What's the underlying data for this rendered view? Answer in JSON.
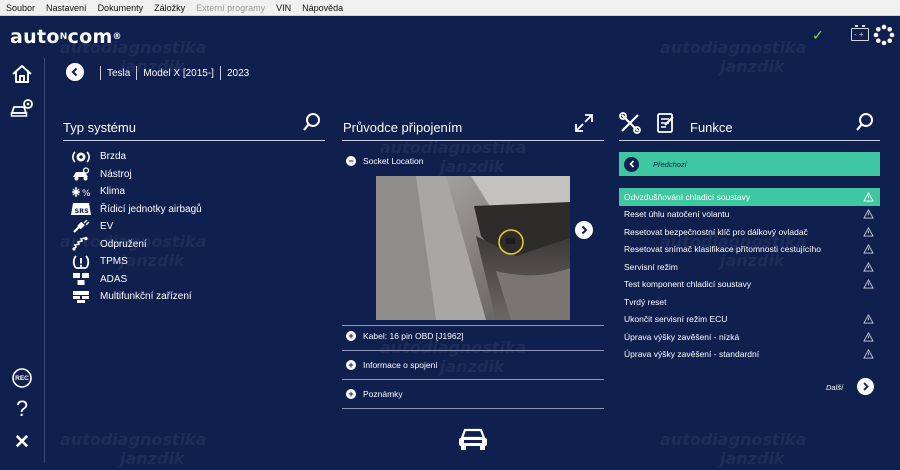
{
  "menubar": {
    "items": [
      "Soubor",
      "Nastavení",
      "Dokumenty",
      "Záložky",
      "Externí programy",
      "VIN",
      "Nápověda"
    ]
  },
  "header": {
    "logo": "auto",
    "logo_mid": "N",
    "logo_end": "com",
    "logo_mark": "®",
    "status_check": "✓"
  },
  "breadcrumb": {
    "make": "Tesla",
    "model": "Model X [2015-]",
    "year": "2023"
  },
  "watermark": {
    "line1": "autodiagnostika",
    "line2": "janzdik"
  },
  "left_panel": {
    "title": "Typ systému",
    "items": [
      {
        "label": "Brzda",
        "icon": "brake-icon"
      },
      {
        "label": "Nástroj",
        "icon": "tool-icon"
      },
      {
        "label": "Klima",
        "icon": "climate-icon"
      },
      {
        "label": "Řídicí jednotky airbagů",
        "icon": "srs-icon",
        "badge": "SRS"
      },
      {
        "label": "EV",
        "icon": "ev-plug-icon"
      },
      {
        "label": "Odpružení",
        "icon": "suspension-icon"
      },
      {
        "label": "TPMS",
        "icon": "tpms-icon"
      },
      {
        "label": "ADAS",
        "icon": "adas-icon"
      },
      {
        "label": "Multifunkční zařízení",
        "icon": "multifunction-icon"
      }
    ]
  },
  "middle_panel": {
    "title": "Průvodce připojením",
    "sections": [
      {
        "label": "Socket Location",
        "expanded": true
      },
      {
        "label": "Kabel: 16 pin OBD [J1962]",
        "expanded": false
      },
      {
        "label": "Informace o spojení",
        "expanded": false
      },
      {
        "label": "Poznámky",
        "expanded": false
      }
    ]
  },
  "right_panel": {
    "title": "Funkce",
    "previous_label": "Předchozí",
    "functions": [
      {
        "label": "Odvzdušňování chladicí soustavy",
        "warning": true,
        "selected": true
      },
      {
        "label": "Reset úhlu natočení volantu",
        "warning": true
      },
      {
        "label": "Resetovat bezpečnostní klíč pro dálkový ovladač",
        "warning": true
      },
      {
        "label": "Resetovat snímač klasifikace přítomnosti cestujícího",
        "warning": true
      },
      {
        "label": "Servisní režim",
        "warning": true
      },
      {
        "label": "Test komponent chladicí soustavy",
        "warning": true
      },
      {
        "label": "Tvrdý reset",
        "warning": false
      },
      {
        "label": "Ukončit servisní režim ECU",
        "warning": true
      },
      {
        "label": "Úprava výšky zavěšení - nízká",
        "warning": true
      },
      {
        "label": "Úprava výšky zavěšení - standardní",
        "warning": true
      }
    ],
    "next_label": "Další"
  },
  "sidebar": {
    "rec_label": "REC",
    "help_label": "?",
    "close_label": "✕"
  },
  "colors": {
    "background": "#0f1f4e",
    "accent": "#3ec7a0",
    "check": "#8bdc4f"
  }
}
